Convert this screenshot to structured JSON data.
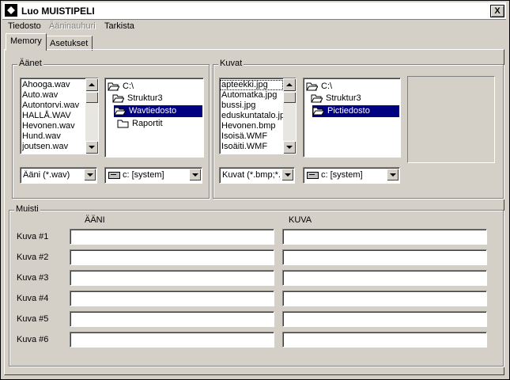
{
  "window": {
    "title": "Luo MUISTIPELI",
    "close_label": "X"
  },
  "menu": [
    {
      "label": "Tiedosto",
      "disabled": false
    },
    {
      "label": "Ääninauhuri",
      "disabled": true
    },
    {
      "label": "Tarkista",
      "disabled": false
    }
  ],
  "tabs": [
    {
      "label": "Memory",
      "active": true
    },
    {
      "label": "Asetukset",
      "active": false
    }
  ],
  "sounds": {
    "group_label": "Äänet",
    "files": [
      "Ahooga.wav",
      "Auto.wav",
      "Autontorvi.wav",
      "HALLÅ.WAV",
      "Hevonen.wav",
      "Hund.wav",
      "joutsen.wav"
    ],
    "dirs": [
      "C:\\",
      "Struktur3",
      "Wavtiedosto",
      "Raportit"
    ],
    "filter": "Ääni (*.wav)",
    "drive": "c: [system]"
  },
  "images": {
    "group_label": "Kuvat",
    "files": [
      "apteekki.jpg",
      "Automatka.jpg",
      "bussi.jpg",
      "eduskuntatalo.jpg",
      "Hevonen.bmp",
      "Isoisä.WMF",
      "Isoäiti.WMF"
    ],
    "dirs": [
      "C:\\",
      "Struktur3",
      "Pictiedosto"
    ],
    "filter": "Kuvat (*.bmp;*.jpg)",
    "drive": "c: [system]"
  },
  "memory": {
    "group_label": "Muisti",
    "col_sound": "ÄÄNI",
    "col_image": "KUVA",
    "rows": [
      {
        "label": "Kuva #1",
        "sound": "",
        "image": ""
      },
      {
        "label": "Kuva #2",
        "sound": "",
        "image": ""
      },
      {
        "label": "Kuva #3",
        "sound": "",
        "image": ""
      },
      {
        "label": "Kuva #4",
        "sound": "",
        "image": ""
      },
      {
        "label": "Kuva #5",
        "sound": "",
        "image": ""
      },
      {
        "label": "Kuva #6",
        "sound": "",
        "image": ""
      }
    ]
  },
  "colors": {
    "selection": "#000080",
    "face": "#d4d0c8"
  }
}
